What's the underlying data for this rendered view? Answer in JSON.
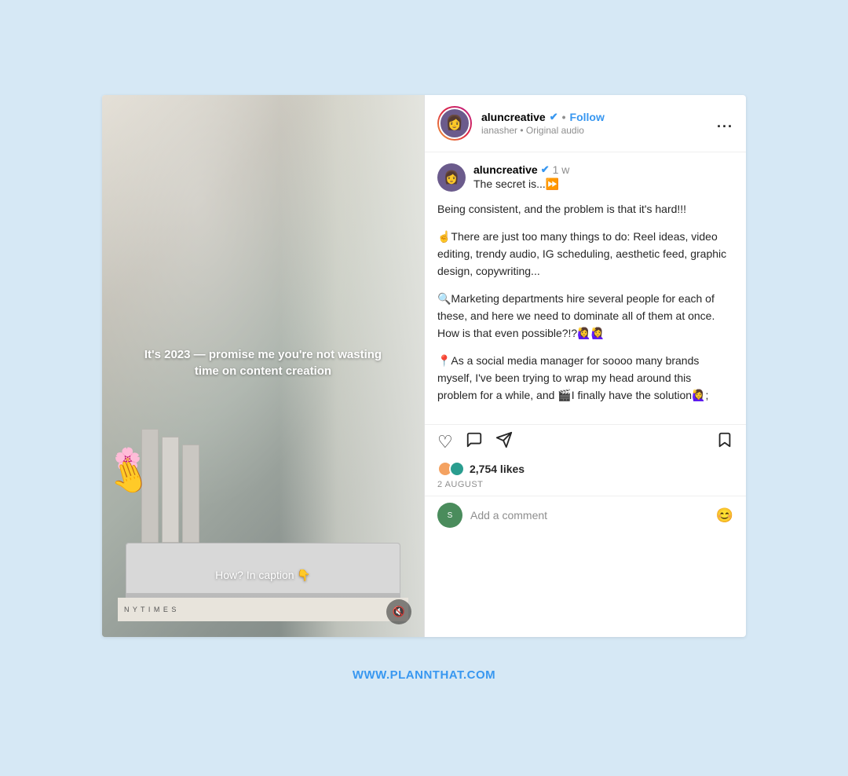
{
  "page": {
    "bg_color": "#d6e8f5",
    "footer_url": "WWW.PLANNTHAT.COM"
  },
  "header": {
    "username": "aluncreative",
    "verified": true,
    "separator": "•",
    "follow_label": "Follow",
    "sub_line": "ianasher • Original audio",
    "more_label": "..."
  },
  "post": {
    "username": "aluncreative",
    "verified": true,
    "time_ago": "1 w",
    "first_line": "The secret is...⏩",
    "paragraphs": [
      "Being consistent, and the problem is that it's hard!!!",
      "☝️There are just too many things to do: Reel ideas, video editing, trendy audio, IG scheduling, aesthetic feed, graphic design, copywriting...",
      "🔍Marketing departments hire several people for each of these, and here we need to dominate all of them at once. How is that even possible?!?🙋‍♀️🙋‍♀️",
      "📍As a social media manager for soooo many brands myself, I've been trying to wrap my head around this problem for a while, and 🎬I finally have the solution🙋‍♀️;"
    ]
  },
  "actions": {
    "like_icon": "♡",
    "comment_icon": "💬",
    "share_icon": "✈",
    "save_icon": "🔖"
  },
  "likes": {
    "count": "2,754 likes"
  },
  "date": "2 AUGUST",
  "comment_placeholder": "Add a comment",
  "image": {
    "overlay_text": "It's 2023 — promise me you're not wasting time on content creation",
    "caption_hint": "How? In caption 👇"
  }
}
